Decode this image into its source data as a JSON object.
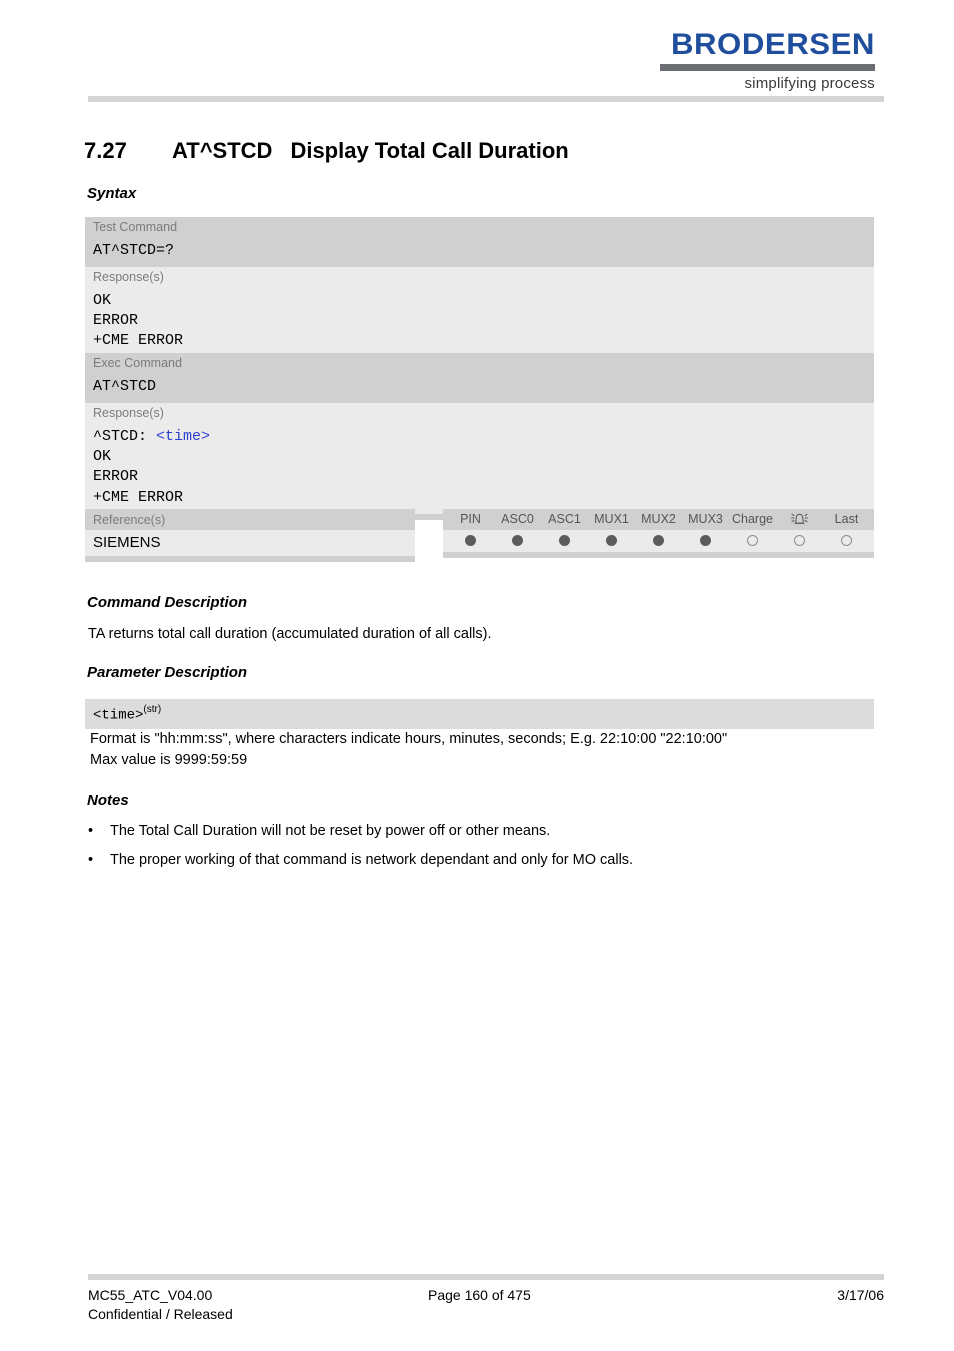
{
  "brand": {
    "name": "BRODERSEN",
    "tagline": "simplifying process",
    "color": "#1f4e9c"
  },
  "section": {
    "number": "7.27",
    "command": "AT^STCD",
    "title": "Display Total Call Duration"
  },
  "headings": {
    "syntax": "Syntax",
    "command_description": "Command Description",
    "parameter_description": "Parameter Description",
    "notes": "Notes"
  },
  "syntax": {
    "test_command": {
      "label": "Test Command",
      "code_prefix": "AT",
      "code_caret": "^",
      "code_suffix": "STCD=?",
      "response_label": "Response(s)",
      "responses": [
        "OK",
        "ERROR",
        "+CME ERROR"
      ]
    },
    "exec_command": {
      "label": "Exec Command",
      "code_prefix": "AT",
      "code_caret": "^",
      "code_suffix": "STCD",
      "response_label": "Response(s)",
      "response_caret": "^",
      "response_head": "STCD: ",
      "response_param": "<time>",
      "responses": [
        "OK",
        "ERROR",
        "+CME ERROR"
      ]
    }
  },
  "reference": {
    "label": "Reference(s)",
    "value": "SIEMENS"
  },
  "capabilities": {
    "columns": [
      "PIN",
      "ASC0",
      "ASC1",
      "MUX1",
      "MUX2",
      "MUX3",
      "Charge",
      "alarm-icon",
      "Last"
    ],
    "states": [
      "filled",
      "filled",
      "filled",
      "filled",
      "filled",
      "filled",
      "empty",
      "empty",
      "empty"
    ]
  },
  "command_description": {
    "text": "TA returns total call duration (accumulated duration of all calls)."
  },
  "parameter": {
    "name": "<time>",
    "type": "(str)",
    "lines": [
      "Format is \"hh:mm:ss\", where characters indicate hours, minutes, seconds; E.g. 22:10:00 \"22:10:00\"",
      "Max value is 9999:59:59"
    ]
  },
  "notes": {
    "bullet": "•",
    "items": [
      "The Total Call Duration will not be reset by power off or other means.",
      "The proper working of that command is network dependant and only for MO calls."
    ]
  },
  "footer": {
    "document": "MC55_ATC_V04.00",
    "page": "Page 160 of 475",
    "date": "3/17/06",
    "classification": "Confidential / Released"
  }
}
